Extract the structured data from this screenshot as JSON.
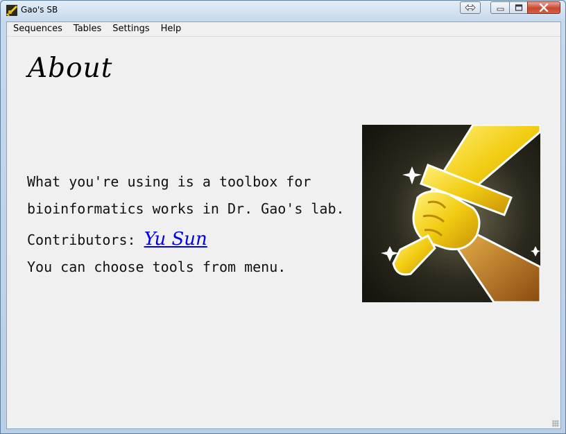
{
  "window": {
    "title": "Gao's SB"
  },
  "menu": [
    "Sequences",
    "Tables",
    "Settings",
    "Help"
  ],
  "page": {
    "heading": "About",
    "description_line1": "What you're using is a toolbox for",
    "description_line2": "bioinformatics works in Dr. Gao's lab.",
    "contributors_label": "Contributors: ",
    "contributor_link": "Yu Sun",
    "instruction": "You can choose tools from menu."
  },
  "colors": {
    "link": "#0000ee",
    "illustration_bg": "#1b1b12",
    "sword_gold": "#f5d21a"
  },
  "icons": {
    "app": "sword-app-icon",
    "illustration": "golden-sword-fist-image"
  }
}
